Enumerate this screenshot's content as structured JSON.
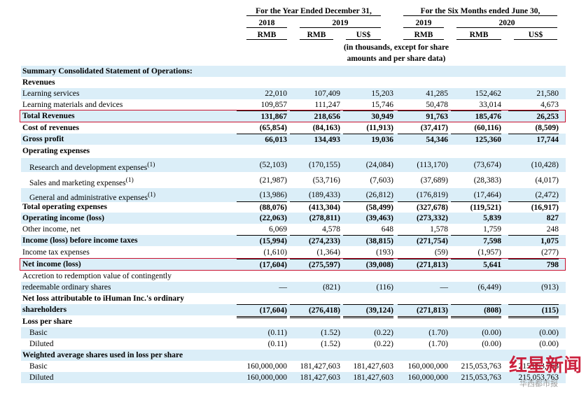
{
  "header": {
    "year_title": "For the Year Ended December 31,",
    "six_title": "For the Six Months ended June 30,",
    "y2018": "2018",
    "y2019": "2019",
    "s2019": "2019",
    "s2020": "2020",
    "cur_rmb1": "RMB",
    "cur_rmb2": "RMB",
    "cur_usd1": "US$",
    "cur_rmb3": "RMB",
    "cur_rmb4": "RMB",
    "cur_usd2": "US$",
    "note_line1": "(in thousands, except for share",
    "note_line2": "amounts and per share data)"
  },
  "rows": [
    {
      "label": "Summary Consolidated Statement of Operations:",
      "values": [
        "",
        "",
        "",
        "",
        "",
        ""
      ]
    },
    {
      "label": "Revenues",
      "values": [
        "",
        "",
        "",
        "",
        "",
        ""
      ]
    },
    {
      "label": "Learning services",
      "values": [
        "22,010",
        "107,409",
        "15,203",
        "41,285",
        "152,462",
        "21,580"
      ]
    },
    {
      "label": "Learning materials and devices",
      "values": [
        "109,857",
        "111,247",
        "15,746",
        "50,478",
        "33,014",
        "4,673"
      ]
    },
    {
      "label": "Total Revenues",
      "values": [
        "131,867",
        "218,656",
        "30,949",
        "91,763",
        "185,476",
        "26,253"
      ]
    },
    {
      "label": "Cost of revenues",
      "values": [
        "(65,854)",
        "(84,163)",
        "(11,913)",
        "(37,417)",
        "(60,116)",
        "(8,509)"
      ]
    },
    {
      "label": "Gross profit",
      "values": [
        "66,013",
        "134,493",
        "19,036",
        "54,346",
        "125,360",
        "17,744"
      ]
    },
    {
      "label": "Operating expenses",
      "values": [
        "",
        "",
        "",
        "",
        "",
        ""
      ]
    },
    {
      "label": "Research and development expenses",
      "sup": "(1)",
      "values": [
        "(52,103)",
        "(170,155)",
        "(24,084)",
        "(113,170)",
        "(73,674)",
        "(10,428)"
      ]
    },
    {
      "label": "Sales and marketing expenses",
      "sup": "(1)",
      "values": [
        "(21,987)",
        "(53,716)",
        "(7,603)",
        "(37,689)",
        "(28,383)",
        "(4,017)"
      ]
    },
    {
      "label": "General and administrative expenses",
      "sup": "(1)",
      "values": [
        "(13,986)",
        "(189,433)",
        "(26,812)",
        "(176,819)",
        "(17,464)",
        "(2,472)"
      ]
    },
    {
      "label": "Total operating expenses",
      "values": [
        "(88,076)",
        "(413,304)",
        "(58,499)",
        "(327,678)",
        "(119,521)",
        "(16,917)"
      ]
    },
    {
      "label": "Operating income (loss)",
      "values": [
        "(22,063)",
        "(278,811)",
        "(39,463)",
        "(273,332)",
        "5,839",
        "827"
      ]
    },
    {
      "label": "Other income, net",
      "values": [
        "6,069",
        "4,578",
        "648",
        "1,578",
        "1,759",
        "248"
      ]
    },
    {
      "label": "Income (loss) before income taxes",
      "values": [
        "(15,994)",
        "(274,233)",
        "(38,815)",
        "(271,754)",
        "7,598",
        "1,075"
      ]
    },
    {
      "label": "Income tax expenses",
      "values": [
        "(1,610)",
        "(1,364)",
        "(193)",
        "(59)",
        "(1,957)",
        "(277)"
      ]
    },
    {
      "label": "Net income (loss)",
      "values": [
        "(17,604)",
        "(275,597)",
        "(39,008)",
        "(271,813)",
        "5,641",
        "798"
      ]
    },
    {
      "label": "Accretion to redemption value of contingently",
      "values": [
        "",
        "",
        "",
        "",
        "",
        ""
      ]
    },
    {
      "label": "redeemable ordinary shares",
      "values": [
        "—",
        "(821)",
        "(116)",
        "—",
        "(6,449)",
        "(913)"
      ]
    },
    {
      "label": "Net loss attributable to iHuman Inc.'s ordinary",
      "values": [
        "",
        "",
        "",
        "",
        "",
        ""
      ]
    },
    {
      "label": "shareholders",
      "values": [
        "(17,604)",
        "(276,418)",
        "(39,124)",
        "(271,813)",
        "(808)",
        "(115)"
      ]
    },
    {
      "label": "Loss per share",
      "values": [
        "",
        "",
        "",
        "",
        "",
        ""
      ]
    },
    {
      "label": "Basic",
      "values": [
        "(0.11)",
        "(1.52)",
        "(0.22)",
        "(1.70)",
        "(0.00)",
        "(0.00)"
      ]
    },
    {
      "label": "Diluted",
      "values": [
        "(0.11)",
        "(1.52)",
        "(0.22)",
        "(1.70)",
        "(0.00)",
        "(0.00)"
      ]
    },
    {
      "label": "Weighted average shares used in loss per share",
      "values": [
        "",
        "",
        "",
        "",
        "",
        ""
      ]
    },
    {
      "label": "Basic",
      "values": [
        "160,000,000",
        "181,427,603",
        "181,427,603",
        "160,000,000",
        "215,053,763",
        "215,053,763"
      ]
    },
    {
      "label": "Diluted",
      "values": [
        "160,000,000",
        "181,427,603",
        "181,427,603",
        "160,000,000",
        "215,053,763",
        "215,053,763"
      ]
    }
  ],
  "watermark": {
    "text": "红星新闻",
    "sub": "华西都市报"
  }
}
